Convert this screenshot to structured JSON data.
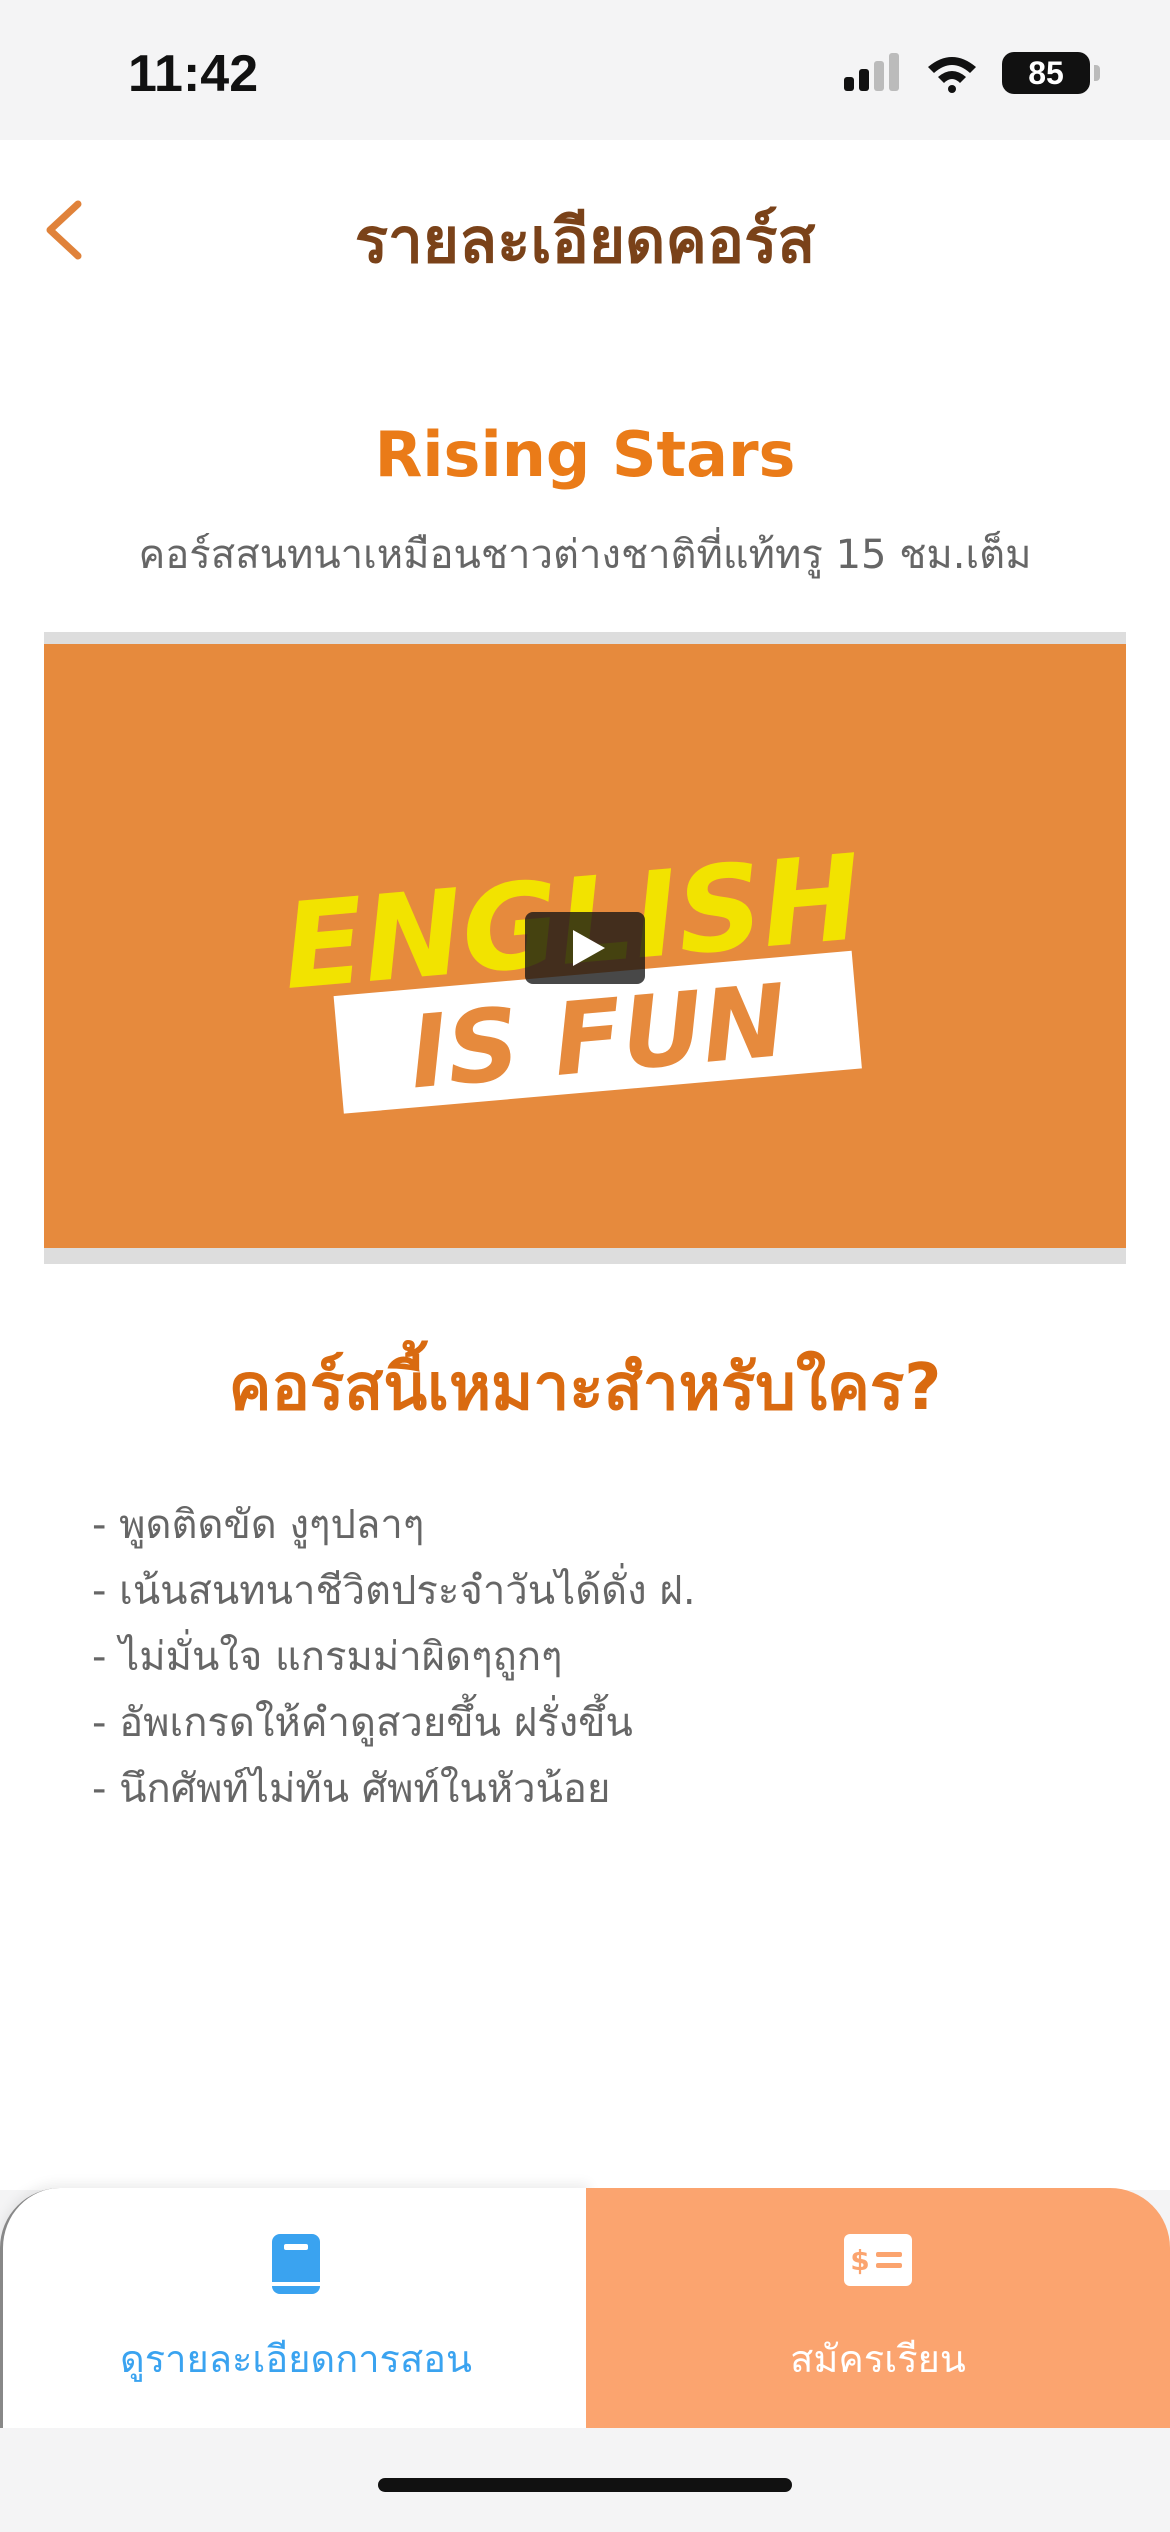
{
  "status_bar": {
    "time": "11:42",
    "battery": "85"
  },
  "header": {
    "title": "รายละเอียดคอร์ส"
  },
  "course": {
    "name": "Rising Stars",
    "subtitle": "คอร์สสนทนาเหมือนชาวต่างชาติที่แท้ทรู 15 ชม.เต็ม"
  },
  "video": {
    "thumbnail_line1": "ENGLISH",
    "thumbnail_line2": "IS FUN"
  },
  "audience": {
    "heading": "คอร์สนี้เหมาะสำหรับใคร?",
    "items": [
      "-  พูดติดขัด งูๆปลาๆ",
      "-  เน้นสนทนาชีวิตประจำวันได้ดั่ง ฝ.",
      "-  ไม่มั่นใจ แกรมม่าผิดๆถูกๆ",
      "-  อัพเกรดให้คำดูสวยขึ้น ฝรั่งขึ้น",
      "-  นึกศัพท์ไม่ทัน ศัพท์ในหัวน้อย"
    ]
  },
  "bottom_bar": {
    "detail_label": "ดูรายละเอียดการสอน",
    "enroll_label": "สมัครเรียน"
  },
  "colors": {
    "title_brown": "#7a4219",
    "accent_orange": "#ea7b18",
    "video_bg": "#e68a3d",
    "enroll_bg": "#fba46f",
    "link_blue": "#3aa3f0"
  }
}
